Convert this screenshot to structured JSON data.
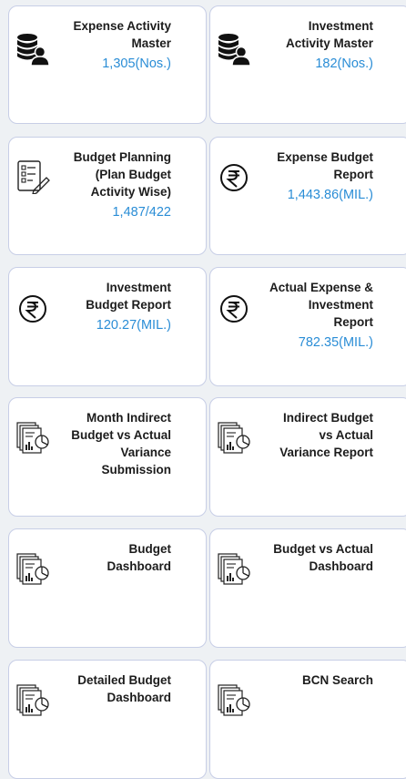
{
  "cards": [
    {
      "title": "Expense Activity\nMaster",
      "value": "1,305(Nos.)",
      "icon": "database-user-icon"
    },
    {
      "title": "Investment\nActivity Master",
      "value": "182(Nos.)",
      "icon": "database-user-icon"
    },
    {
      "title": "Budget Planning\n(Plan Budget\nActivity Wise)",
      "value": "1,487/422",
      "icon": "checklist-pen-icon"
    },
    {
      "title": "Expense Budget\nReport",
      "value": "1,443.86(MIL.)",
      "icon": "rupee-icon"
    },
    {
      "title": "Investment\nBudget Report",
      "value": "120.27(MIL.)",
      "icon": "rupee-icon"
    },
    {
      "title": "Actual Expense &\nInvestment\nReport",
      "value": "782.35(MIL.)",
      "icon": "rupee-icon"
    },
    {
      "title": "Month Indirect\nBudget vs Actual\nVariance\nSubmission",
      "value": "",
      "icon": "report-chart-icon"
    },
    {
      "title": "Indirect Budget\nvs Actual\nVariance Report",
      "value": "",
      "icon": "report-chart-icon"
    },
    {
      "title": "Budget\nDashboard",
      "value": "",
      "icon": "report-chart-icon"
    },
    {
      "title": "Budget vs Actual\nDashboard",
      "value": "",
      "icon": "report-chart-icon"
    },
    {
      "title": "Detailed Budget\nDashboard",
      "value": "",
      "icon": "report-chart-icon"
    },
    {
      "title": "BCN Search",
      "value": "",
      "icon": "report-chart-icon"
    }
  ],
  "colors": {
    "value": "#2a8dd6",
    "title": "#1c1c1c",
    "card_border": "#c7cee6",
    "background": "#eef1f4"
  }
}
